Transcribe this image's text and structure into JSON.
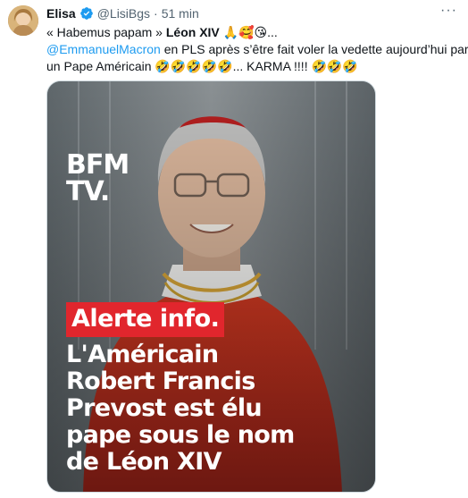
{
  "tweet": {
    "author_name": "Elisa",
    "author_handle": "@LisiBgs",
    "separator": "·",
    "time": "51 min",
    "more": "···",
    "text_line1_prefix": "« Habemus papam » ",
    "text_line1_bold": "Léon XIV",
    "text_line1_suffix": " 🙏🥰😘...",
    "mention": "@EmmanuelMacron",
    "text_line2_rest": " en PLS après s’être fait voler la vedette aujourd’hui par",
    "text_line3": "un Pape Américain 🤣🤣🤣🤣🤣... KARMA !!!! 🤣🤣🤣"
  },
  "media": {
    "logo_line1": "BFM",
    "logo_line2": "TV.",
    "badge": "Alerte info.",
    "headline_lines": [
      "L'Américain",
      "Robert Francis",
      "Prevost est élu",
      "pape sous le nom",
      "de Léon XIV"
    ]
  },
  "colors": {
    "link": "#1d9bf0",
    "verified": "#1d9bf0",
    "badge": "#e1262d",
    "cassock": "#c8321f"
  }
}
